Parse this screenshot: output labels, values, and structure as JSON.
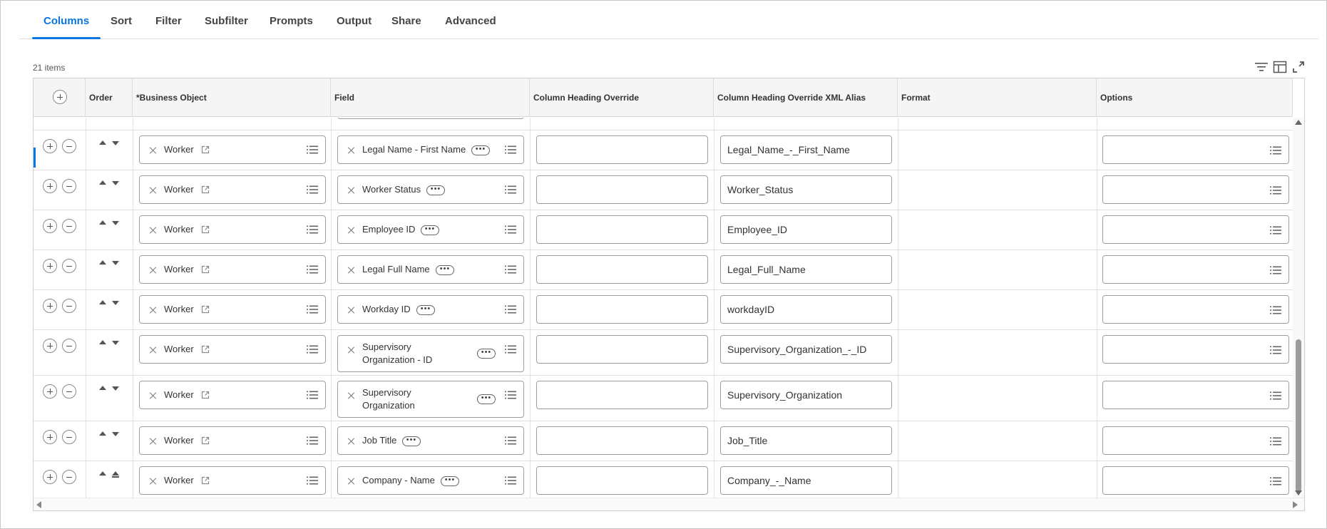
{
  "tabs": [
    {
      "label": "Columns",
      "active": true
    },
    {
      "label": "Sort"
    },
    {
      "label": "Filter"
    },
    {
      "label": "Subfilter"
    },
    {
      "label": "Prompts"
    },
    {
      "label": "Output"
    },
    {
      "label": "Share"
    },
    {
      "label": "Advanced"
    }
  ],
  "item_count": "21 items",
  "toolbar_icons": [
    "filter-icon",
    "column-layout-icon",
    "expand-icon"
  ],
  "columns": [
    "Order",
    "*Business Object",
    "Field",
    "Column Heading Override",
    "Column Heading Override XML Alias",
    "Format",
    "Options"
  ],
  "rows": [
    {
      "business_object": "Worker",
      "field": "Legal Name - First Name",
      "heading_override": "",
      "xml_alias": "Legal_Name_-_First_Name",
      "selected": true
    },
    {
      "business_object": "Worker",
      "field": "Worker Status",
      "heading_override": "",
      "xml_alias": "Worker_Status"
    },
    {
      "business_object": "Worker",
      "field": "Employee ID",
      "heading_override": "",
      "xml_alias": "Employee_ID"
    },
    {
      "business_object": "Worker",
      "field": "Legal Full Name",
      "heading_override": "",
      "xml_alias": "Legal_Full_Name"
    },
    {
      "business_object": "Worker",
      "field": "Workday ID",
      "heading_override": "",
      "xml_alias": "workdayID"
    },
    {
      "business_object": "Worker",
      "field": [
        "Supervisory",
        "Organization - ID"
      ],
      "heading_override": "",
      "xml_alias": "Supervisory_Organization_-_ID"
    },
    {
      "business_object": "Worker",
      "field": [
        "Supervisory",
        "Organization"
      ],
      "heading_override": "",
      "xml_alias": "Supervisory_Organization"
    },
    {
      "business_object": "Worker",
      "field": "Job Title",
      "heading_override": "",
      "xml_alias": "Job_Title"
    },
    {
      "business_object": "Worker",
      "field": "Company - Name",
      "heading_override": "",
      "xml_alias": "Company_-_Name",
      "last": true
    }
  ],
  "colors": {
    "accent": "#0875e1",
    "header_bg": "#f5f5f5",
    "border": "#9aa0a6"
  }
}
